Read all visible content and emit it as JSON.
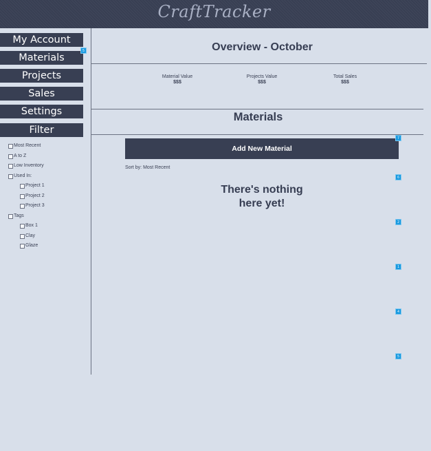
{
  "app": {
    "title": "CraftTracker"
  },
  "nav": {
    "my_account": "My Account",
    "materials": "Materials",
    "materials_badge": "5",
    "projects": "Projects",
    "sales": "Sales",
    "settings": "Settings",
    "filter": "Filter"
  },
  "filters": {
    "most_recent": "Most Recent",
    "a_to_z": "A to Z",
    "low_inventory": "Low Inventory",
    "used_in": "Used In:",
    "project_1": "Project 1",
    "project_2": "Project 2",
    "project_3": "Project 3",
    "tags": "Tags",
    "box_1": "Box 1",
    "clay": "Clay",
    "glaze": "Glaze"
  },
  "overview": {
    "title": "Overview - October",
    "stats": [
      {
        "label": "Material Value",
        "value": "$$$"
      },
      {
        "label": "Projects Value",
        "value": "$$$"
      },
      {
        "label": "Total Sales",
        "value": "$$$"
      }
    ]
  },
  "materials": {
    "title": "Materials",
    "add_button": "Add New Material",
    "sort_by": "Sort by: Most Recent",
    "empty_line1": "There's nothing",
    "empty_line2": "here yet!"
  },
  "side_badges": [
    "7",
    "6",
    "2",
    "1",
    "4",
    "5"
  ],
  "colors": {
    "header": "#383f53",
    "background": "#d8dfea",
    "badge": "#1a9ae0"
  }
}
